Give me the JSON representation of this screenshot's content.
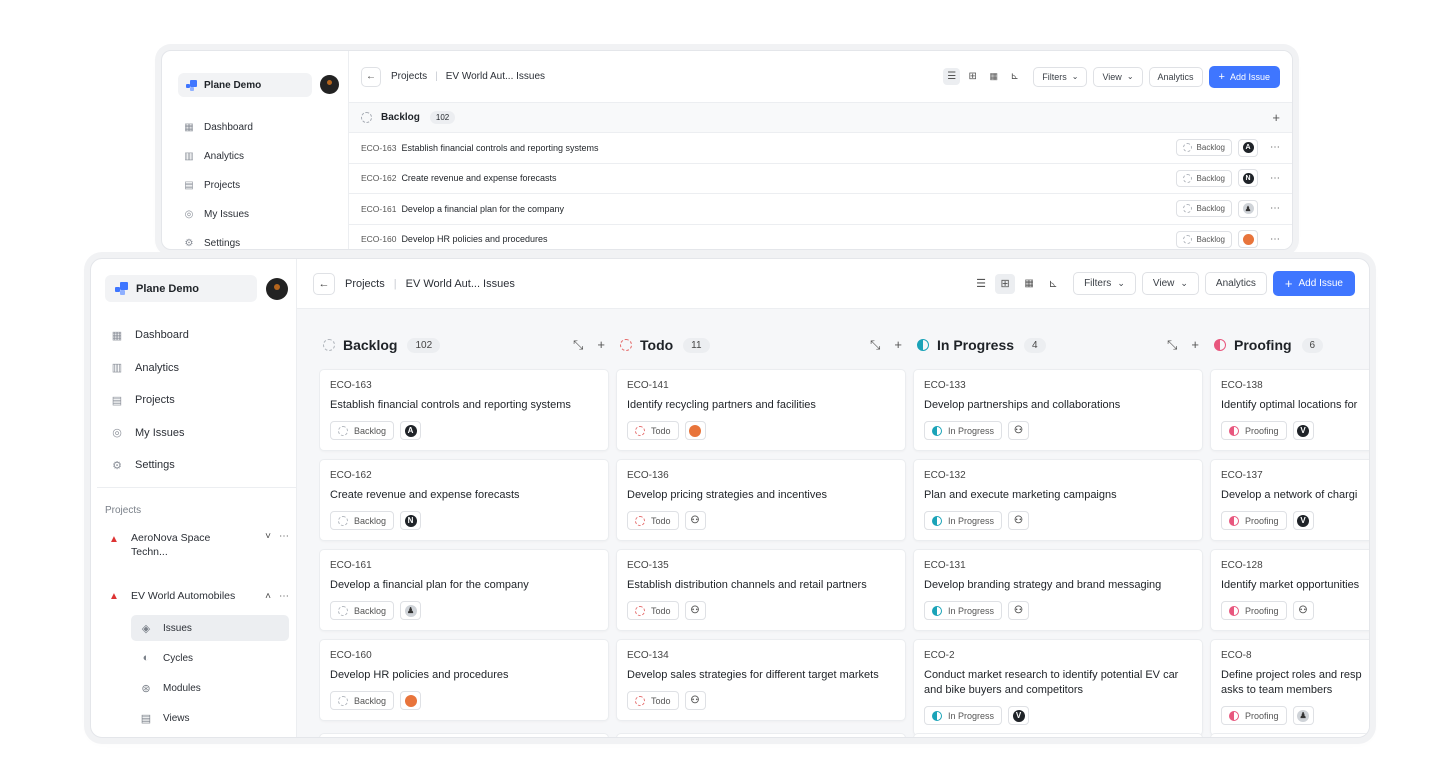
{
  "workspace": {
    "name": "Plane Demo"
  },
  "nav": [
    {
      "label": "Dashboard",
      "icon": "grid-icon"
    },
    {
      "label": "Analytics",
      "icon": "bar-chart-icon"
    },
    {
      "label": "Projects",
      "icon": "clipboard-icon"
    },
    {
      "label": "My Issues",
      "icon": "check-circle-icon"
    },
    {
      "label": "Settings",
      "icon": "gear-icon"
    }
  ],
  "projects_section": {
    "label": "Projects",
    "items": [
      {
        "name_line1": "AeroNova Space",
        "name_line2": "Techn...",
        "expanded": false
      },
      {
        "name_line1": "EV World Automobiles",
        "name_line2": "",
        "expanded": true
      }
    ],
    "subnav": [
      {
        "label": "Issues",
        "icon": "layers-icon",
        "active": true
      },
      {
        "label": "Cycles",
        "icon": "cycle-icon",
        "active": false
      },
      {
        "label": "Modules",
        "icon": "modules-icon",
        "active": false
      },
      {
        "label": "Views",
        "icon": "views-icon",
        "active": false
      }
    ]
  },
  "header": {
    "breadcrumb_projects": "Projects",
    "breadcrumb_issues": "EV World Aut... Issues",
    "filters": "Filters",
    "view": "View",
    "analytics": "Analytics",
    "add_issue": "Add Issue",
    "back_symbol": "←",
    "chevron": "⌄",
    "plus": "+"
  },
  "list_view": {
    "group": {
      "name": "Backlog",
      "count": "102"
    },
    "rows": [
      {
        "id": "ECO-163",
        "title": "Establish financial controls and reporting systems",
        "state": "Backlog",
        "assignee": "A"
      },
      {
        "id": "ECO-162",
        "title": "Create revenue and expense forecasts",
        "state": "Backlog",
        "assignee": "N"
      },
      {
        "id": "ECO-161",
        "title": "Develop a financial plan for the company",
        "state": "Backlog",
        "assignee": "ghost"
      },
      {
        "id": "ECO-160",
        "title": "Develop HR policies and procedures",
        "state": "Backlog",
        "assignee": "photo"
      }
    ]
  },
  "board": {
    "columns": [
      {
        "name": "Backlog",
        "count": "102",
        "state": "back",
        "cards": [
          {
            "id": "ECO-163",
            "title": "Establish financial controls and reporting systems",
            "state": "Backlog",
            "assignee": "A"
          },
          {
            "id": "ECO-162",
            "title": "Create revenue and expense forecasts",
            "state": "Backlog",
            "assignee": "N"
          },
          {
            "id": "ECO-161",
            "title": "Develop a financial plan for the company",
            "state": "Backlog",
            "assignee": "ghost"
          },
          {
            "id": "ECO-160",
            "title": "Develop HR policies and procedures",
            "state": "Backlog",
            "assignee": "photo"
          }
        ]
      },
      {
        "name": "Todo",
        "count": "11",
        "state": "todo",
        "cards": [
          {
            "id": "ECO-141",
            "title": "Identify recycling partners and facilities",
            "state": "Todo",
            "assignee": "photo"
          },
          {
            "id": "ECO-136",
            "title": "Develop pricing strategies and incentives",
            "state": "Todo",
            "assignee": "none"
          },
          {
            "id": "ECO-135",
            "title": "Establish distribution channels and retail partners",
            "state": "Todo",
            "assignee": "none"
          },
          {
            "id": "ECO-134",
            "title": "Develop sales strategies for different target markets",
            "state": "Todo",
            "assignee": "none"
          }
        ]
      },
      {
        "name": "In Progress",
        "count": "4",
        "state": "prog",
        "cards": [
          {
            "id": "ECO-133",
            "title": "Develop partnerships and collaborations",
            "state": "In Progress",
            "assignee": "none"
          },
          {
            "id": "ECO-132",
            "title": "Plan and execute marketing campaigns",
            "state": "In Progress",
            "assignee": "none"
          },
          {
            "id": "ECO-131",
            "title": "Develop branding strategy and brand messaging",
            "state": "In Progress",
            "assignee": "none"
          },
          {
            "id": "ECO-2",
            "title": "Conduct market research to identify potential EV car and bike buyers and competitors",
            "state": "In Progress",
            "assignee": "V"
          }
        ]
      },
      {
        "name": "Proofing",
        "count": "6",
        "state": "proof",
        "cards": [
          {
            "id": "ECO-138",
            "title": "Identify optimal locations for",
            "state": "Proofing",
            "assignee": "V"
          },
          {
            "id": "ECO-137",
            "title": "Develop a network of chargi",
            "state": "Proofing",
            "assignee": "V"
          },
          {
            "id": "ECO-128",
            "title": "Identify market opportunities",
            "state": "Proofing",
            "assignee": "none"
          },
          {
            "id": "ECO-8",
            "title": "Define project roles and resp asks to team members",
            "state": "Proofing",
            "assignee": "ghost"
          }
        ]
      }
    ]
  },
  "colors": {
    "accent": "#3f76ff",
    "backlog": "#b0b5bc",
    "todo": "#e56b6b",
    "in_progress": "#1aa3b8",
    "proofing": "#e8577e"
  }
}
